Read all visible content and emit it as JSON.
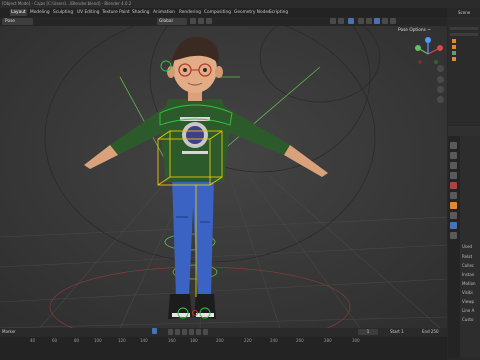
{
  "title_bar": {
    "text": "[Object Mode] - Cajas [C:\\Users\\...\\Blender.blend] - Blender 4.0.2"
  },
  "workspace_tabs": [
    {
      "label": "Layout",
      "active": true
    },
    {
      "label": "Modeling"
    },
    {
      "label": "Sculpting"
    },
    {
      "label": "UV Editing"
    },
    {
      "label": "Texture Paint"
    },
    {
      "label": "Shading"
    },
    {
      "label": "Animation"
    },
    {
      "label": "Rendering"
    },
    {
      "label": "Compositing"
    },
    {
      "label": "Geometry Nodes"
    },
    {
      "label": "Scripting"
    }
  ],
  "viewport": {
    "mode": "Pose",
    "orientation": "Global",
    "pose_options": "Pose Options ~"
  },
  "right_panel": {
    "scene_label": "Scene",
    "property_rows": [
      "Used",
      "Relat",
      "Collec",
      "Instan",
      "Motion",
      "Visibi",
      "Viewp",
      "Line A",
      "Custo"
    ]
  },
  "timeline": {
    "marker_label": "Marker",
    "current_frame": "1",
    "start_label": "Start",
    "start_value": "1",
    "end_label": "End",
    "end_value": "250",
    "frame_numbers": [
      "40",
      "60",
      "80",
      "100",
      "120",
      "140",
      "160",
      "180",
      "200",
      "220",
      "240",
      "260",
      "280",
      "300"
    ]
  },
  "colors": {
    "viewport_bg": "#3a3a3a",
    "panel_bg": "#282828",
    "accent_blue": "#4772b3",
    "selection_yellow": "#e8c600",
    "bone_green": "#35c43d"
  }
}
